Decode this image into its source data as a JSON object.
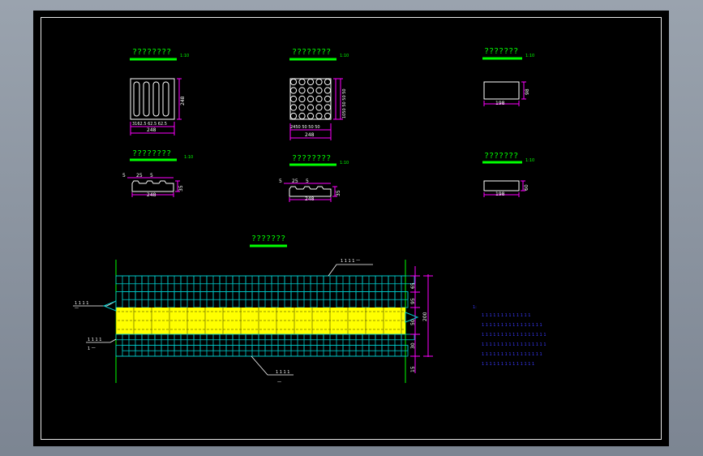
{
  "titles": {
    "strip_tile_plan": "????????",
    "dot_tile_plan": "????????",
    "plain_tile_plan": "???????",
    "strip_tile_section": "????????",
    "dot_tile_section": "????????",
    "plain_tile_section": "???????",
    "pavement_plan": "???????"
  },
  "scales": {
    "strip_tile_plan": "1:10",
    "dot_tile_plan": "1:10",
    "plain_tile_plan": "1:10",
    "strip_tile_section": "1:10",
    "dot_tile_section": "1:10",
    "plain_tile_section": "1:10"
  },
  "dims": {
    "strip_plan_w": "248",
    "strip_plan_h": "248",
    "strip_plan_sub": "3162.5 62.5 62.5",
    "dot_plan_w": "248",
    "dot_plan_h": "1050 50 50 50",
    "dot_plan_sub": "2450 50 50 50",
    "plain_plan_w": "198",
    "plain_plan_h": "98",
    "strip_sec_a": "5",
    "strip_sec_b": "25",
    "strip_sec_c": "5",
    "strip_sec_w": "248",
    "strip_sec_h": "35",
    "dot_sec_a": "5",
    "dot_sec_b": "25",
    "dot_sec_c": "5",
    "dot_sec_w": "248",
    "dot_sec_h": "35",
    "plain_sec_w": "198",
    "plain_sec_h": "60",
    "pav_d1": "65",
    "pav_d2": "95",
    "pav_d3": "50",
    "pav_d4": "30",
    "pav_d5": "15",
    "pav_total": "200"
  },
  "tags": {
    "top": "1 1 1 1 一",
    "left_top": "1 1 1 1",
    "left_top_sub": "一",
    "left_mid": "1 1 1 1",
    "left_mid_sub": "1 一",
    "bottom": "1 1 1 1",
    "bottom_sub": "一"
  },
  "notes": {
    "head": "1:",
    "lines": [
      "1 1 1 1 1 1 1 1 1 1 1 1 1",
      "1 1 1 1 1 1 1 1 1 1 1 1 1 1 1 1",
      "1 1 1 1 1 1 1 1 1 1 1 1 1 1 1 1 1",
      "1 1 1 1 1 1 1 1 1 1 1 1 1 1 1 1 1",
      "1 1 1 1 1 1 1 1 1 1 1 1 1 1 1 1",
      "1 1 1 1 1 1 1 1 1 1 1 1 1 1"
    ]
  },
  "colors": {
    "background": "#000000",
    "title_green": "#00ff00",
    "dim_magenta": "#ff00ff",
    "outline_white": "#ffffff",
    "paver_cyan": "#00c8c8",
    "guide_yellow": "#ffff00",
    "note_blue": "#3a3aff"
  }
}
